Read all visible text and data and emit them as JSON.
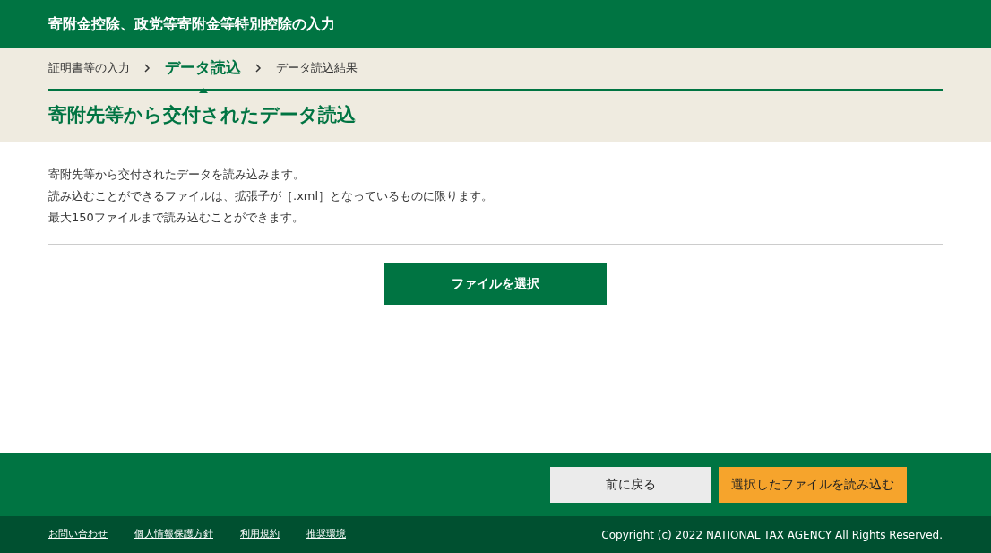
{
  "header": {
    "title": "寄附金控除、政党等寄附金等特別控除の入力"
  },
  "breadcrumb": [
    {
      "label": "証明書等の入力",
      "selected": false
    },
    {
      "label": "データ読込",
      "selected": true
    },
    {
      "label": "データ読込結果",
      "selected": false
    }
  ],
  "page_title": "寄附先等から交付されたデータ読込",
  "description": [
    "寄附先等から交付されたデータを読み込みます。",
    "読み込むことができるファイルは、拡張子が［.xml］となっているものに限ります。",
    "最大150ファイルまで読み込むことができます。"
  ],
  "file_button": "ファイルを選択",
  "actions": [
    {
      "label": "前に戻る",
      "kind": "secondary"
    },
    {
      "label": "選択したファイルを読み込む",
      "kind": "primary"
    }
  ],
  "footer": {
    "links": [
      "お問い合わせ",
      "個人情報保護方針",
      "利用規約",
      "推奨環境"
    ],
    "copyright": "Copyright (c) 2022 NATIONAL TAX AGENCY All Rights Reserved."
  }
}
